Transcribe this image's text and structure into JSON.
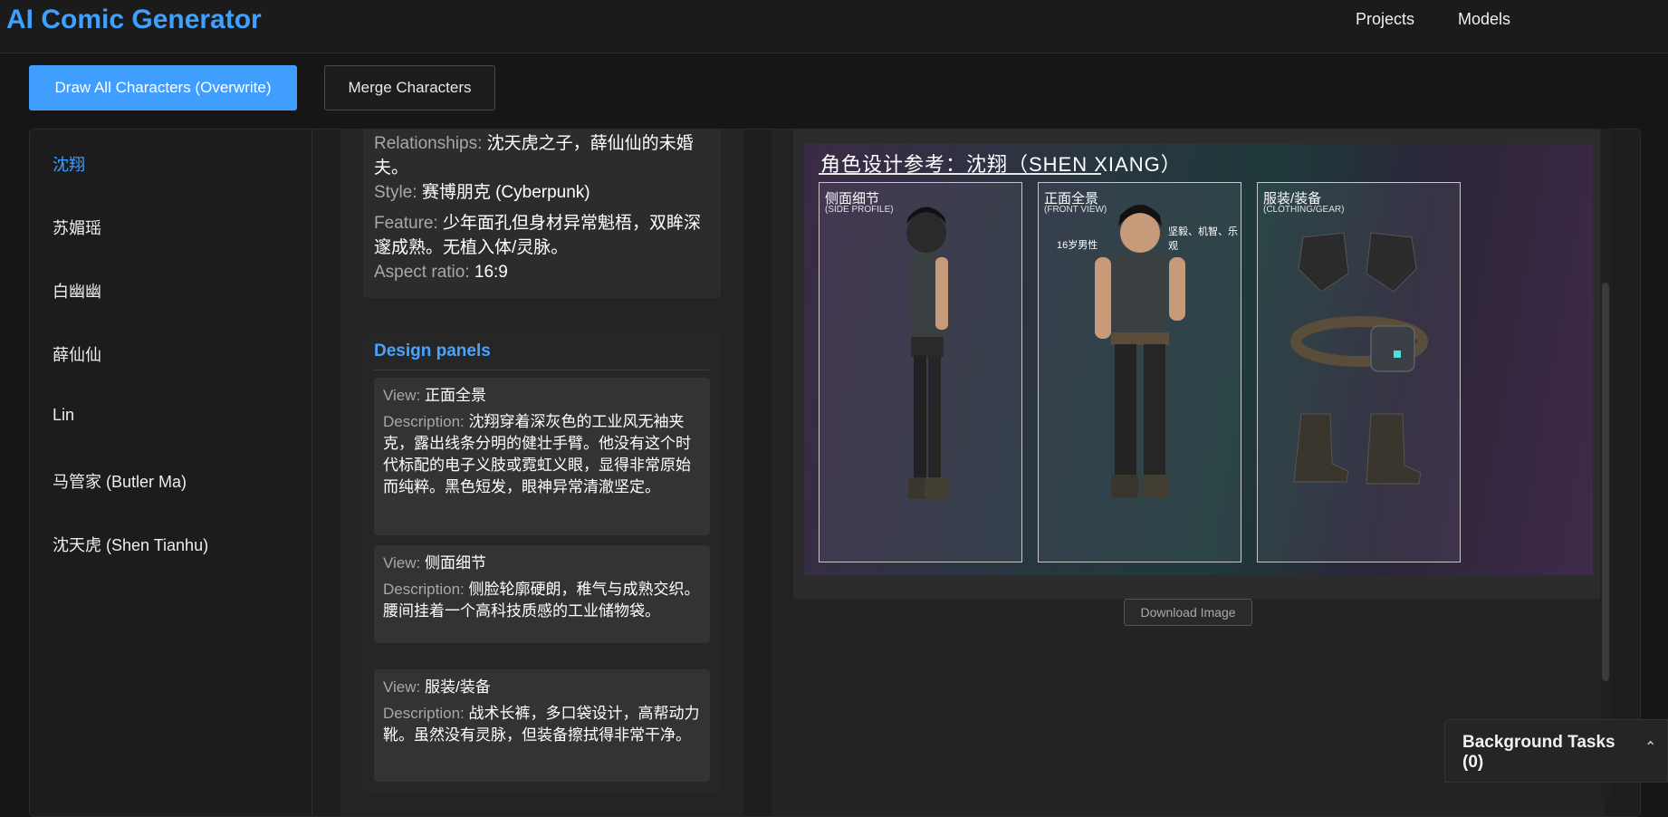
{
  "header": {
    "brand": "AI Comic Generator",
    "nav": [
      {
        "label": "Projects"
      },
      {
        "label": "Models"
      }
    ]
  },
  "toolbar": {
    "draw_all_label": "Draw All Characters (Overwrite)",
    "merge_label": "Merge Characters"
  },
  "sidebar": {
    "items": [
      {
        "label": "沈翔",
        "active": true
      },
      {
        "label": "苏媚瑶"
      },
      {
        "label": "白幽幽"
      },
      {
        "label": "薛仙仙"
      },
      {
        "label": "Lin"
      },
      {
        "label": "马管家 (Butler Ma)"
      },
      {
        "label": "沈天虎 (Shen Tianhu)"
      }
    ]
  },
  "character": {
    "relationships_key": "Relationships:",
    "relationships_value": "沈天虎之子，薛仙仙的未婚夫。",
    "style_key": "Style:",
    "style_value": "赛博朋克 (Cyberpunk)",
    "feature_key": "Feature:",
    "feature_value": "少年面孔但身材异常魁梧，双眸深邃成熟。无植入体/灵脉。",
    "aspect_key": "Aspect ratio:",
    "aspect_value": "16:9"
  },
  "design_panels": {
    "title": "Design panels",
    "view_key": "View:",
    "desc_key": "Description:",
    "panels": [
      {
        "view": "正面全景",
        "description": "沈翔穿着深灰色的工业风无袖夹克，露出线条分明的健壮手臂。他没有这个时代标配的电子义肢或霓虹义眼，显得非常原始而纯粹。黑色短发，眼神异常清澈坚定。"
      },
      {
        "view": "侧面细节",
        "description": "侧脸轮廓硬朗，稚气与成熟交织。腰间挂着一个高科技质感的工业储物袋。"
      },
      {
        "view": "服装/装备",
        "description": "战术长裤，多口袋设计，高帮动力靴。虽然没有灵脉，但装备擦拭得非常干净。"
      }
    ]
  },
  "image": {
    "title": "角色设计参考：沈翔（SHEN XIANG）",
    "boxes": [
      {
        "label": "侧面细节",
        "sub": "(SIDE PROFILE)"
      },
      {
        "label": "正面全景",
        "sub": "(FRONT VIEW)"
      },
      {
        "label": "服装/装备",
        "sub": "(CLOTHING/GEAR)"
      }
    ],
    "callout_age": "16岁男性",
    "callout_traits": "坚毅、机智、乐观",
    "download_label": "Download Image"
  },
  "background_tasks": {
    "label": "Background Tasks (0)"
  },
  "colors": {
    "accent": "#409eff",
    "brand": "#3ea0ff",
    "background": "#161616"
  }
}
